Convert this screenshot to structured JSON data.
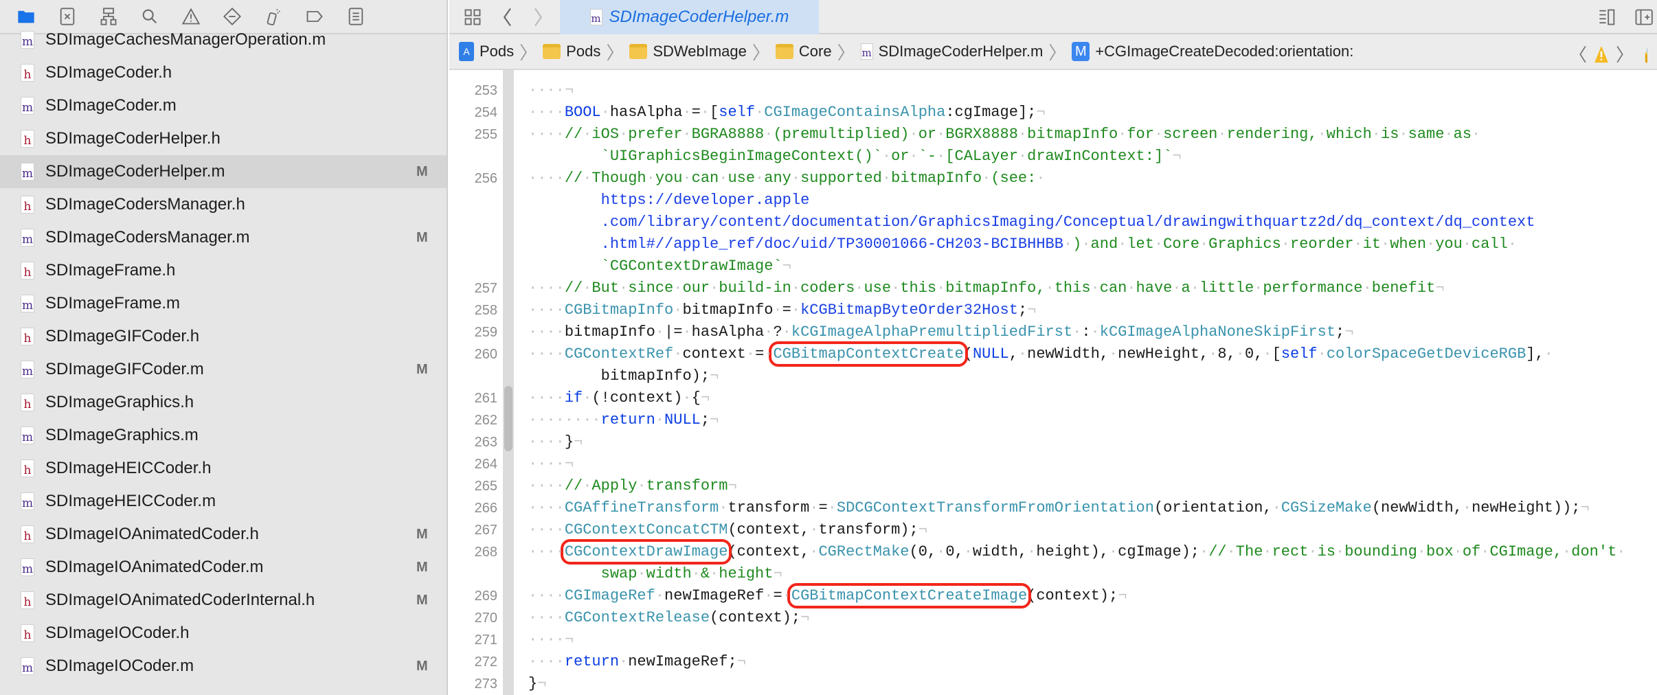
{
  "sidebar": {
    "toolbar_icons": [
      "folder-icon",
      "source-control-icon",
      "hierarchy-icon",
      "search-icon",
      "warning-icon",
      "test-diamond-icon",
      "debug-spray-icon",
      "breakpoint-tag-icon",
      "report-list-icon"
    ],
    "files": [
      {
        "name": "SDImageCachesManagerOperation.m",
        "type": "m",
        "badge": ""
      },
      {
        "name": "SDImageCoder.h",
        "type": "h",
        "badge": ""
      },
      {
        "name": "SDImageCoder.m",
        "type": "m",
        "badge": ""
      },
      {
        "name": "SDImageCoderHelper.h",
        "type": "h",
        "badge": ""
      },
      {
        "name": "SDImageCoderHelper.m",
        "type": "m",
        "badge": "M",
        "selected": true
      },
      {
        "name": "SDImageCodersManager.h",
        "type": "h",
        "badge": ""
      },
      {
        "name": "SDImageCodersManager.m",
        "type": "m",
        "badge": "M"
      },
      {
        "name": "SDImageFrame.h",
        "type": "h",
        "badge": ""
      },
      {
        "name": "SDImageFrame.m",
        "type": "m",
        "badge": ""
      },
      {
        "name": "SDImageGIFCoder.h",
        "type": "h",
        "badge": ""
      },
      {
        "name": "SDImageGIFCoder.m",
        "type": "m",
        "badge": "M"
      },
      {
        "name": "SDImageGraphics.h",
        "type": "h",
        "badge": ""
      },
      {
        "name": "SDImageGraphics.m",
        "type": "m",
        "badge": ""
      },
      {
        "name": "SDImageHEICCoder.h",
        "type": "h",
        "badge": ""
      },
      {
        "name": "SDImageHEICCoder.m",
        "type": "m",
        "badge": ""
      },
      {
        "name": "SDImageIOAnimatedCoder.h",
        "type": "h",
        "badge": "M"
      },
      {
        "name": "SDImageIOAnimatedCoder.m",
        "type": "m",
        "badge": "M"
      },
      {
        "name": "SDImageIOAnimatedCoderInternal.h",
        "type": "h",
        "badge": "M"
      },
      {
        "name": "SDImageIOCoder.h",
        "type": "h",
        "badge": ""
      },
      {
        "name": "SDImageIOCoder.m",
        "type": "m",
        "badge": "M"
      }
    ]
  },
  "editor": {
    "tab": {
      "label": "SDImageCoderHelper.m",
      "icon": "m"
    },
    "breadcrumb": {
      "project": "Pods",
      "folder1": "Pods",
      "folder2": "SDWebImage",
      "folder3": "Core",
      "file": "SDImageCoderHelper.m",
      "method_badge": "M",
      "method": "+CGImageCreateDecoded:orientation:"
    },
    "colors": {
      "comment": "#1f8a1f",
      "keyword": "#0b3ee3",
      "function": "#3a93ad",
      "highlight_box": "#f2261b",
      "accent": "#1a6ee0"
    },
    "lines": [
      {
        "n": "253",
        "lead": 4,
        "segs": [],
        "eol": true
      },
      {
        "n": "254",
        "lead": 4,
        "segs": [
          [
            "k",
            "BOOL"
          ],
          [
            "p",
            " hasAlpha = ["
          ],
          [
            "k",
            "self"
          ],
          [
            "p",
            " "
          ],
          [
            "f",
            "CGImageContainsAlpha"
          ],
          [
            "p",
            ":cgImage];"
          ]
        ],
        "eol": true
      },
      {
        "n": "255",
        "lead": 4,
        "segs": [
          [
            "c",
            "// iOS prefer BGRA8888 (premultiplied) or BGRX8888 bitmapInfo for screen rendering, which is same as "
          ]
        ],
        "eol": false
      },
      {
        "n": "",
        "cont": true,
        "segs": [
          [
            "c",
            "`UIGraphicsBeginImageContext()` or `- [CALayer drawInContext:]`"
          ]
        ],
        "eol": true
      },
      {
        "n": "256",
        "lead": 4,
        "segs": [
          [
            "c",
            "// Though you can use any supported bitmapInfo (see: "
          ]
        ],
        "eol": false
      },
      {
        "n": "",
        "cont": true,
        "segs": [
          [
            "u",
            "https://developer.apple"
          ]
        ],
        "eol": false
      },
      {
        "n": "",
        "cont": true,
        "segs": [
          [
            "u",
            ".com/library/content/documentation/GraphicsImaging/Conceptual/drawingwithquartz2d/dq_context/dq_context"
          ]
        ],
        "eol": false
      },
      {
        "n": "",
        "cont": true,
        "segs": [
          [
            "u",
            ".html#//apple_ref/doc/uid/TP30001066-CH203-BCIBHHBB"
          ],
          [
            "c",
            " ) and let Core Graphics reorder it when you call "
          ]
        ],
        "eol": false
      },
      {
        "n": "",
        "cont": true,
        "segs": [
          [
            "c",
            "`CGContextDrawImage`"
          ]
        ],
        "eol": true
      },
      {
        "n": "257",
        "lead": 4,
        "segs": [
          [
            "c",
            "// But since our build-in coders use this bitmapInfo, this can have a little performance benefit"
          ]
        ],
        "eol": true
      },
      {
        "n": "258",
        "lead": 4,
        "segs": [
          [
            "f",
            "CGBitmapInfo"
          ],
          [
            "p",
            " bitmapInfo = "
          ],
          [
            "m",
            "kCGBitmapByteOrder32Host"
          ],
          [
            "p",
            ";"
          ]
        ],
        "eol": true
      },
      {
        "n": "259",
        "lead": 4,
        "segs": [
          [
            "p",
            "bitmapInfo |= hasAlpha ? "
          ],
          [
            "f",
            "kCGImageAlphaPremultipliedFirst"
          ],
          [
            "p",
            " : "
          ],
          [
            "f",
            "kCGImageAlphaNoneSkipFirst"
          ],
          [
            "p",
            ";"
          ]
        ],
        "eol": true
      },
      {
        "n": "260",
        "lead": 4,
        "segs": [
          [
            "f",
            "CGContextRef"
          ],
          [
            "p",
            " context = "
          ],
          [
            "f hl",
            "CGBitmapContextCreate"
          ],
          [
            "p",
            "("
          ],
          [
            "k",
            "NULL"
          ],
          [
            "p",
            ", newWidth, newHeight, 8, 0, ["
          ],
          [
            "k",
            "self"
          ],
          [
            "p",
            " "
          ],
          [
            "f",
            "colorSpaceGetDeviceRGB"
          ],
          [
            "p",
            "], "
          ]
        ],
        "eol": false
      },
      {
        "n": "",
        "cont": true,
        "segs": [
          [
            "p",
            "bitmapInfo);"
          ]
        ],
        "eol": true
      },
      {
        "n": "261",
        "lead": 4,
        "segs": [
          [
            "k",
            "if"
          ],
          [
            "p",
            " (!context) {"
          ]
        ],
        "eol": true
      },
      {
        "n": "262",
        "lead": 8,
        "segs": [
          [
            "k",
            "return"
          ],
          [
            "p",
            " "
          ],
          [
            "k",
            "NULL"
          ],
          [
            "p",
            ";"
          ]
        ],
        "eol": true
      },
      {
        "n": "263",
        "lead": 4,
        "segs": [
          [
            "p",
            "}"
          ]
        ],
        "eol": true
      },
      {
        "n": "264",
        "lead": 4,
        "segs": [],
        "eol": true
      },
      {
        "n": "265",
        "lead": 4,
        "segs": [
          [
            "c",
            "// Apply transform"
          ]
        ],
        "eol": true
      },
      {
        "n": "266",
        "lead": 4,
        "segs": [
          [
            "f",
            "CGAffineTransform"
          ],
          [
            "p",
            " transform = "
          ],
          [
            "f",
            "SDCGContextTransformFromOrientation"
          ],
          [
            "p",
            "(orientation, "
          ],
          [
            "f",
            "CGSizeMake"
          ],
          [
            "p",
            "(newWidth, newHeight));"
          ]
        ],
        "eol": true
      },
      {
        "n": "267",
        "lead": 4,
        "segs": [
          [
            "f",
            "CGContextConcatCTM"
          ],
          [
            "p",
            "(context, transform);"
          ]
        ],
        "eol": true
      },
      {
        "n": "268",
        "lead": 4,
        "segs": [
          [
            "f hl",
            "CGContextDrawImage"
          ],
          [
            "p",
            "(context, "
          ],
          [
            "f",
            "CGRectMake"
          ],
          [
            "p",
            "(0, 0, width, height), cgImage); "
          ],
          [
            "c",
            "// The rect is bounding box of CGImage, don't "
          ]
        ],
        "eol": false
      },
      {
        "n": "",
        "cont": true,
        "segs": [
          [
            "c",
            "swap width & height"
          ]
        ],
        "eol": true
      },
      {
        "n": "269",
        "lead": 4,
        "segs": [
          [
            "f",
            "CGImageRef"
          ],
          [
            "p",
            " newImageRef = "
          ],
          [
            "f hl",
            "CGBitmapContextCreateImage"
          ],
          [
            "p",
            "(context);"
          ]
        ],
        "eol": true
      },
      {
        "n": "270",
        "lead": 4,
        "segs": [
          [
            "f",
            "CGContextRelease"
          ],
          [
            "p",
            "(context);"
          ]
        ],
        "eol": true
      },
      {
        "n": "271",
        "lead": 4,
        "segs": [],
        "eol": true
      },
      {
        "n": "272",
        "lead": 4,
        "segs": [
          [
            "k",
            "return"
          ],
          [
            "p",
            " newImageRef;"
          ]
        ],
        "eol": true
      },
      {
        "n": "273",
        "lead": 0,
        "segs": [
          [
            "p",
            "}"
          ]
        ],
        "eol": true
      }
    ]
  }
}
